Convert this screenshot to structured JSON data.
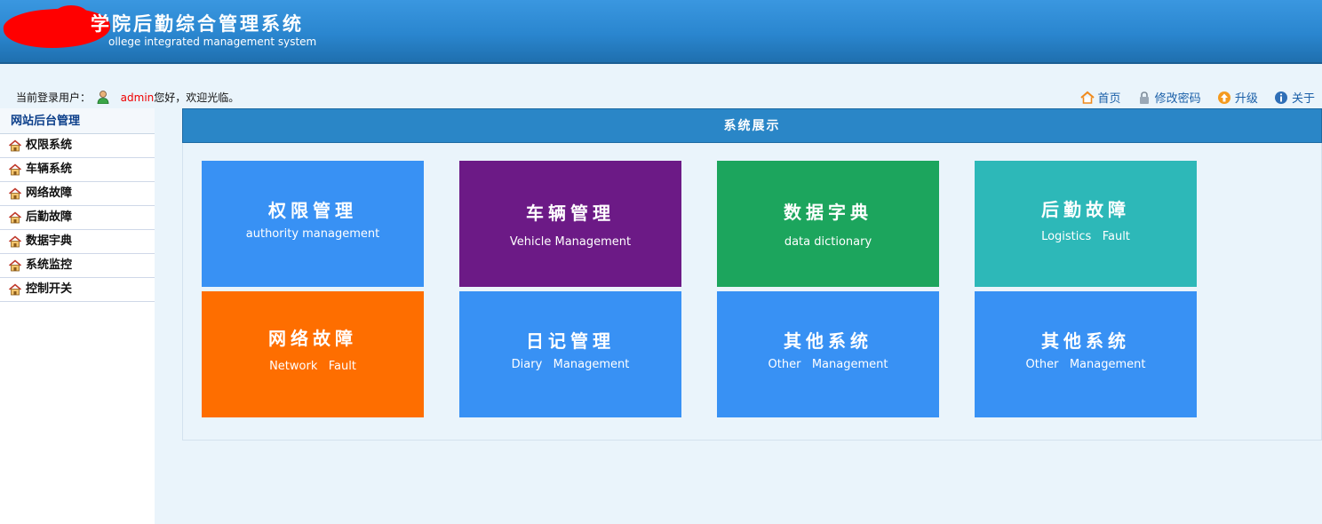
{
  "header": {
    "title": "学院后勤综合管理系统",
    "subtitle": "ollege integrated management system"
  },
  "topbar": {
    "login_prefix": "当前登录用户：",
    "username": "admin",
    "greeting": "您好，欢迎光临。",
    "links": [
      {
        "label": "首页",
        "icon": "home-icon"
      },
      {
        "label": "修改密码",
        "icon": "lock-icon"
      },
      {
        "label": "升级",
        "icon": "upgrade-icon"
      },
      {
        "label": "关于",
        "icon": "info-icon"
      }
    ]
  },
  "sidebar": {
    "title": "网站后台管理",
    "items": [
      {
        "label": "权限系统"
      },
      {
        "label": "车辆系统"
      },
      {
        "label": "网络故障"
      },
      {
        "label": "后勤故障"
      },
      {
        "label": "数据宇典"
      },
      {
        "label": "系统监控"
      },
      {
        "label": "控制开关"
      }
    ]
  },
  "main": {
    "title": "系统展示",
    "tiles": [
      {
        "zh": "权限管理",
        "en": "authority management",
        "color": "#3891f4"
      },
      {
        "zh": "车辆管理",
        "en": "Vehicle Management",
        "color": "#6c1a86"
      },
      {
        "zh": "数据字典",
        "en": "data dictionary",
        "color": "#1ca55d"
      },
      {
        "zh": "后勤故障",
        "en": "Logistics   Fault",
        "color": "#2db8b8"
      },
      {
        "zh": "网络故障",
        "en": "Network   Fault",
        "color": "#fe6e00"
      },
      {
        "zh": "日记管理",
        "en": "Diary   Management",
        "color": "#3891f4"
      },
      {
        "zh": "其他系统",
        "en": "Other   Management",
        "color": "#3891f4"
      },
      {
        "zh": "其他系统",
        "en": "Other   Management",
        "color": "#3891f4"
      }
    ]
  }
}
